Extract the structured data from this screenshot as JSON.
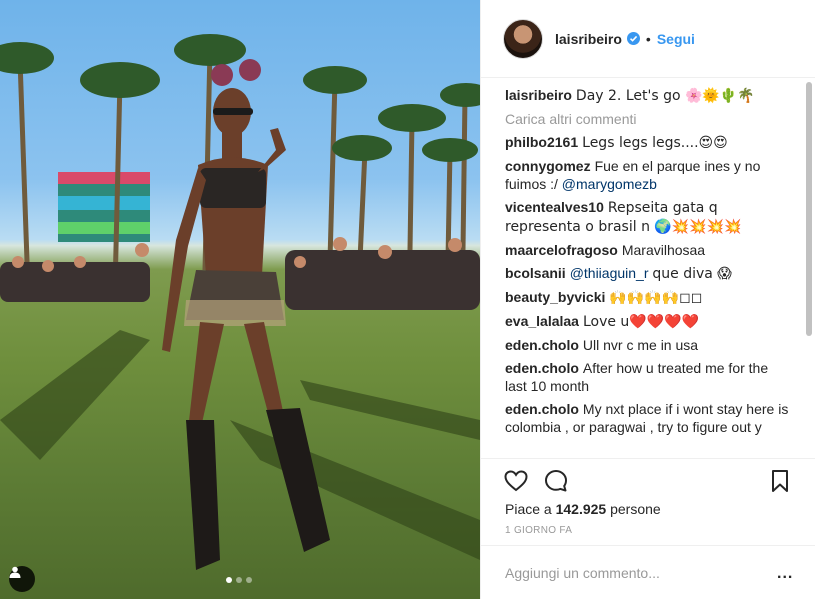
{
  "post": {
    "username": "laisribeiro",
    "follow_label": "Segui",
    "separator": "•",
    "caption_text": "Day 2. Let's go 🌸🌞🌵🌴",
    "load_more": "Carica altri commenti"
  },
  "comments": [
    {
      "user": "philbo2161",
      "text": "Legs legs legs....😍😍"
    },
    {
      "user": "connygomez",
      "text": "Fue en el parque ines y no fuimos :/",
      "mention": "@marygomezb"
    },
    {
      "user": "vicentealves10",
      "text": "Repseita gata q representa o brasil n 🌍💥💥💥💥"
    },
    {
      "user": "maarcelofragoso",
      "text": "Maravilhosaa"
    },
    {
      "user": "bcolsanii",
      "mention": "@thiiaguin_r",
      "text": "que diva 😱"
    },
    {
      "user": "beauty_byvicki",
      "text": "🙌🙌🙌🙌◻◻"
    },
    {
      "user": "eva_lalalaa",
      "text": "Love u❤️❤️❤️❤️"
    },
    {
      "user": "eden.cholo",
      "text": "Ull nvr c me in usa"
    },
    {
      "user": "eden.cholo",
      "text": "After how u treated me for the last 10 month"
    },
    {
      "user": "eden.cholo",
      "text": "My nxt place if i wont stay here is colombia , or paragwai , try to figure out y"
    }
  ],
  "likes": {
    "prefix": "Piace a ",
    "count": "142.925",
    "suffix": " persone"
  },
  "timestamp": "1 GIORNO FA",
  "add_comment": {
    "placeholder": "Aggiungi un commento...",
    "more_label": "..."
  },
  "carousel": {
    "total": 3,
    "active": 1
  },
  "colors": {
    "accent": "#3897f0",
    "muted": "#999999",
    "verified": "#3897f0"
  },
  "icons": [
    "user-tag-icon",
    "verified-badge-icon",
    "heart-icon",
    "comment-icon",
    "bookmark-icon",
    "more-options-icon"
  ]
}
